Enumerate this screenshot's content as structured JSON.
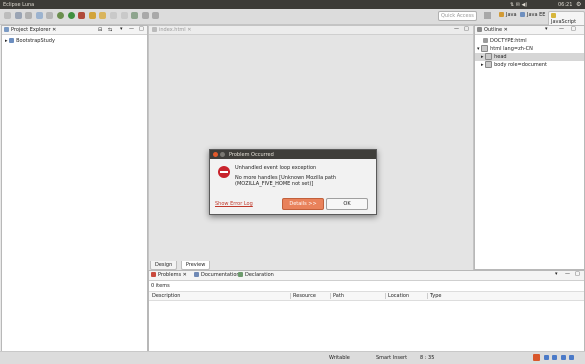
{
  "window": {
    "title": "Eclipse Luna"
  },
  "topbar": {
    "time": "06:21"
  },
  "toolbar": {
    "quick_access_placeholder": "Quick Access",
    "perspectives": [
      {
        "label": "Java"
      },
      {
        "label": "Java EE"
      },
      {
        "label": "JavaScript"
      }
    ]
  },
  "project_explorer": {
    "tab": "Project Explorer",
    "items": [
      {
        "label": "BootstrapStudy"
      }
    ]
  },
  "editor": {
    "tab": "index.html",
    "bottom_tabs": [
      {
        "label": "Design"
      },
      {
        "label": "Preview"
      }
    ]
  },
  "outline": {
    "tab": "Outline",
    "items": [
      {
        "label": "DOCTYPE:html"
      },
      {
        "label": "html lang=zh-CN"
      },
      {
        "label": "head"
      },
      {
        "label": "body role=document"
      }
    ]
  },
  "problems": {
    "tabs": [
      {
        "label": "Problems"
      },
      {
        "label": "Documentation"
      },
      {
        "label": "Declaration"
      }
    ],
    "count": "0 items",
    "columns": [
      "Description",
      "Resource",
      "Path",
      "Location",
      "Type"
    ]
  },
  "dialog": {
    "title": "Problem Occurred",
    "message": "Unhandled event loop exception",
    "detail": "No more handles [Unknown Mozilla path (MOZILLA_FIVE_HOME not set)]",
    "link": "Show Error Log",
    "details_button": "Details >>",
    "ok_button": "OK"
  },
  "status": {
    "writable": "Writable",
    "insert": "Smart Insert",
    "position": "8 : 35"
  }
}
